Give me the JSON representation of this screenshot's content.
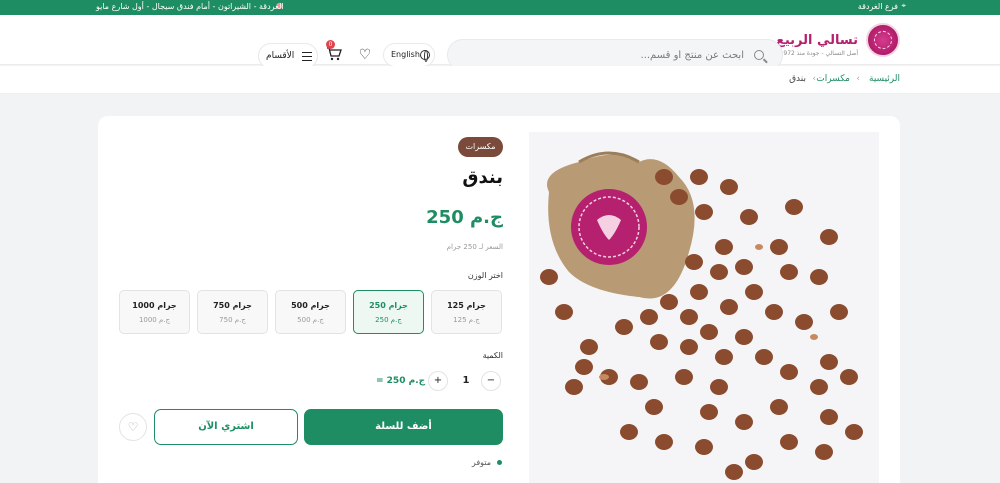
{
  "topbar": {
    "branch": "فرع الغردقة",
    "address": "الغردقة - الشيراتون - أمام فندق سيجال - أول شارع مايو"
  },
  "header": {
    "brand_name": "تسالي الربيع",
    "brand_tagline": "أصل التسالي - جودة منذ 1972",
    "search_placeholder": "ابحث عن منتج أو قسم...",
    "language": "English",
    "cart_count": "0",
    "categories": "الأقسام"
  },
  "breadcrumb": {
    "home": "الرئيسية",
    "sep": "‹",
    "category": "مكسرات",
    "current": "بندق"
  },
  "product": {
    "category": "مكسرات",
    "name": "بندق",
    "price": "250 ج.م",
    "unit_price": "السعر لـ 250 جرام",
    "weight_label": "اختر الوزن",
    "weights": [
      {
        "label": "125 جرام",
        "price": "125 ج.م"
      },
      {
        "label": "250 جرام",
        "price": "250 ج.م"
      },
      {
        "label": "500 جرام",
        "price": "500 ج.م"
      },
      {
        "label": "750 جرام",
        "price": "750 ج.م"
      },
      {
        "label": "1000 جرام",
        "price": "1000 ج.م"
      }
    ],
    "selected_weight": "250 جرام",
    "qty_label": "الكمية",
    "qty_minus": "−",
    "qty_value": "1",
    "qty_plus": "+",
    "qty_total": "= 250 ج.م",
    "add_to_cart": "أضف للسلة",
    "buy_now": "اشتري الآن",
    "stock": "متوفر"
  },
  "colors": {
    "primary": "#1e8d63",
    "brand": "#b5216e",
    "category_pill": "#7a4a3a"
  }
}
